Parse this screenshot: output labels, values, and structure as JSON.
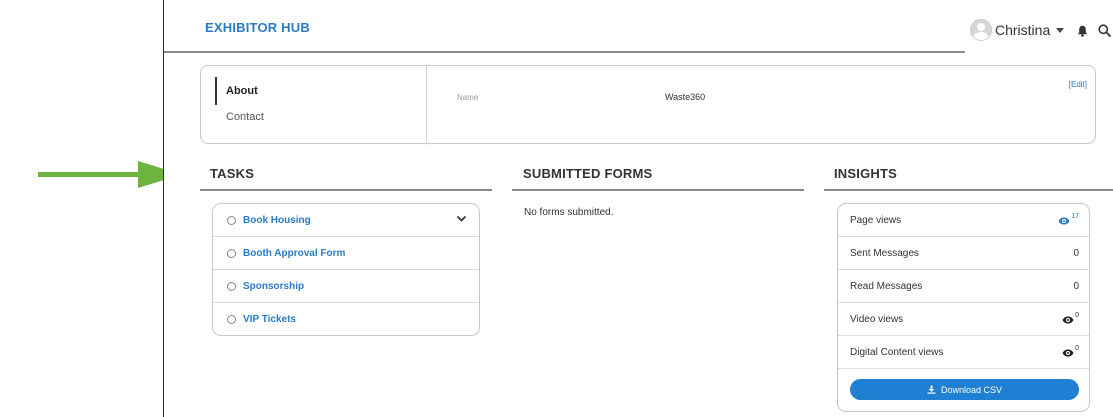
{
  "header": {
    "brand": "EXHIBITOR HUB",
    "user_name": "Christina"
  },
  "profile": {
    "nav": [
      "About",
      "Contact"
    ],
    "field_label": "Name",
    "field_value": "Waste360",
    "edit_label": "[Edit]"
  },
  "sections": {
    "tasks_title": "TASKS",
    "forms_title": "SUBMITTED FORMS",
    "insights_title": "INSIGHTS"
  },
  "tasks": [
    {
      "label": "Book Housing"
    },
    {
      "label": "Booth Approval Form"
    },
    {
      "label": "Sponsorship"
    },
    {
      "label": "VIP Tickets"
    }
  ],
  "forms": {
    "empty_text": "No forms submitted."
  },
  "insights": {
    "rows": [
      {
        "label": "Page views",
        "value": "17",
        "icon": "eye-icon"
      },
      {
        "label": "Sent Messages",
        "value": "0"
      },
      {
        "label": "Read Messages",
        "value": "0"
      },
      {
        "label": "Video views",
        "value": "0",
        "icon": "eye-icon"
      },
      {
        "label": "Digital Content views",
        "value": "0",
        "icon": "eye-icon"
      }
    ],
    "download_label": "Download CSV"
  },
  "colors": {
    "accent": "#2a7bc4",
    "button": "#1f7fd1",
    "annotation_arrow": "#6db33f"
  }
}
